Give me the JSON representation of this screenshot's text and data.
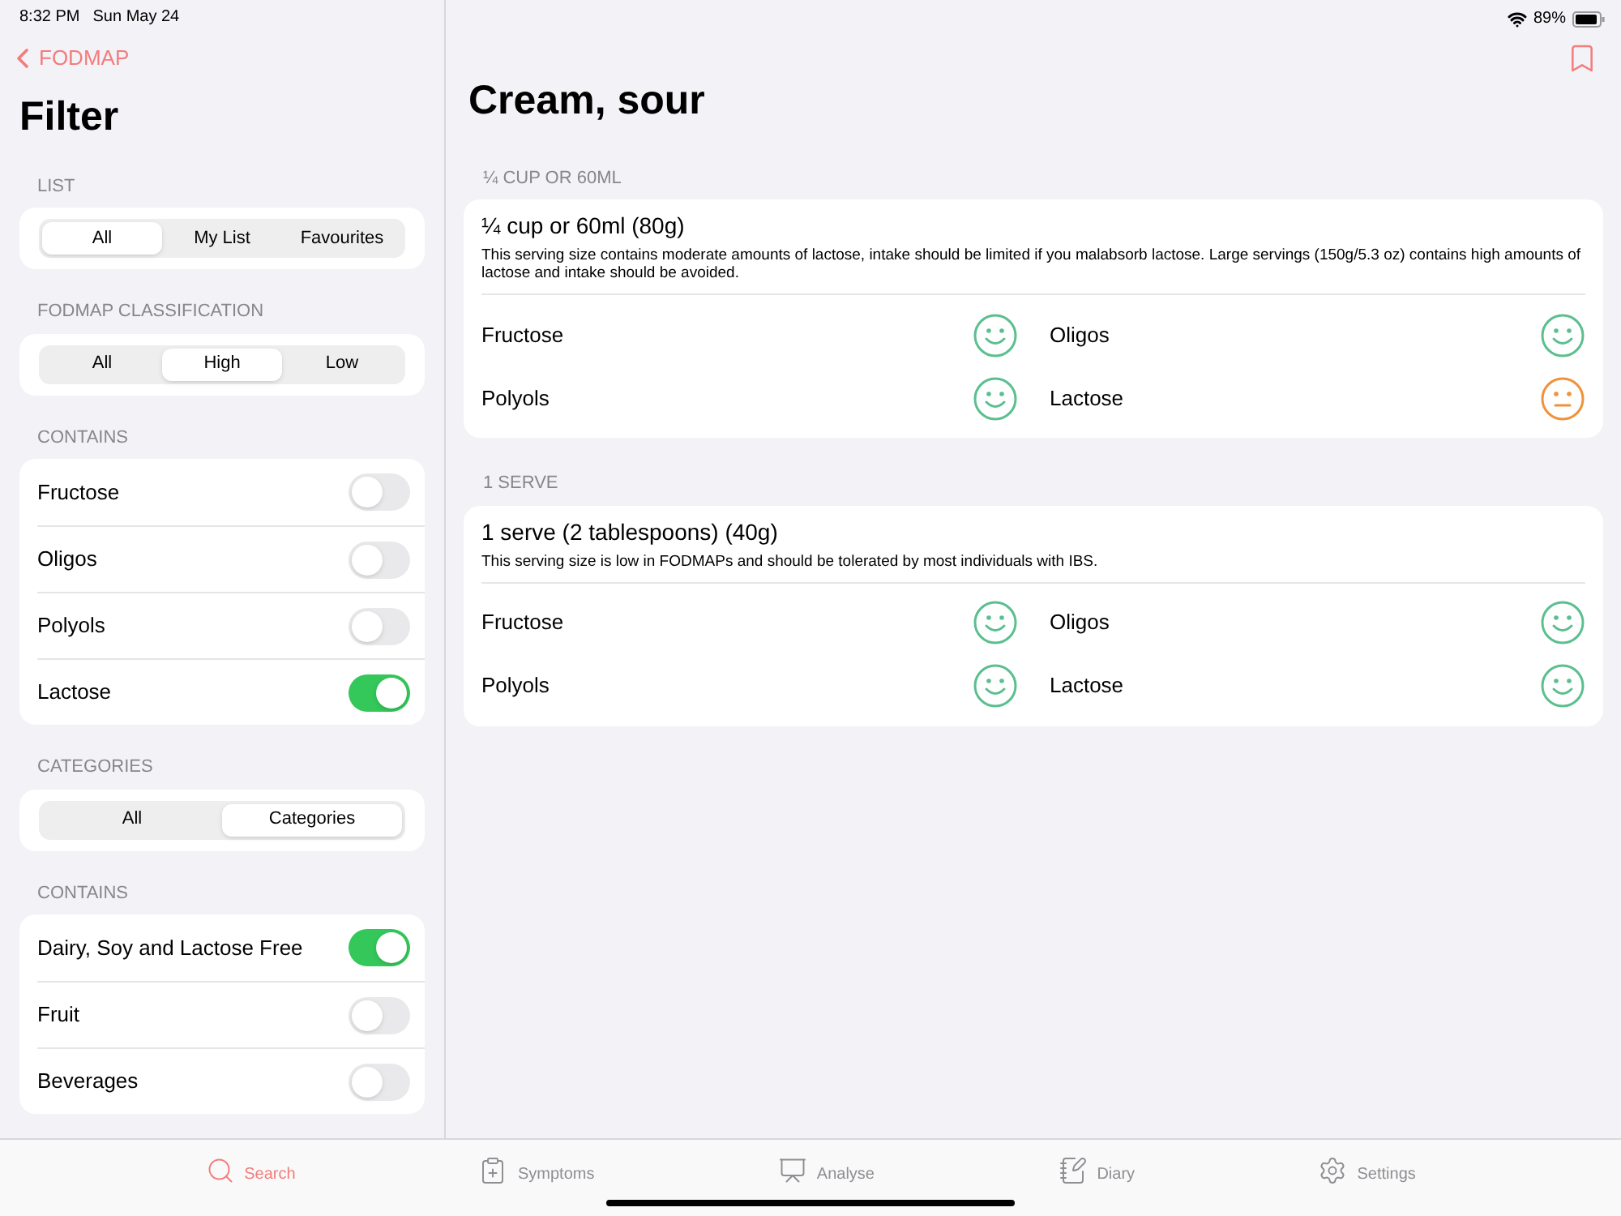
{
  "status_bar": {
    "time": "8:32 PM",
    "date": "Sun May 24",
    "battery": "89%"
  },
  "sidebar": {
    "back": "FODMAP",
    "title": "Filter",
    "sections": [
      {
        "kind": "segment",
        "header": "LIST",
        "options": [
          {
            "label": "All",
            "selected": true
          },
          {
            "label": "My List",
            "selected": false
          },
          {
            "label": "Favourites",
            "selected": false
          }
        ]
      },
      {
        "kind": "segment",
        "header": "FODMAP CLASSIFICATION",
        "options": [
          {
            "label": "All",
            "selected": false
          },
          {
            "label": "High",
            "selected": true
          },
          {
            "label": "Low",
            "selected": false
          }
        ]
      },
      {
        "kind": "toggles",
        "header": "CONTAINS",
        "items": [
          {
            "label": "Fructose",
            "on": false
          },
          {
            "label": "Oligos",
            "on": false
          },
          {
            "label": "Polyols",
            "on": false
          },
          {
            "label": "Lactose",
            "on": true
          }
        ]
      },
      {
        "kind": "segment",
        "header": "CATEGORIES",
        "options": [
          {
            "label": "All",
            "selected": false
          },
          {
            "label": "Categories",
            "selected": true
          }
        ]
      },
      {
        "kind": "toggles",
        "header": "CONTAINS",
        "items": [
          {
            "label": "Dairy, Soy and Lactose Free",
            "on": true
          },
          {
            "label": "Fruit",
            "on": false
          },
          {
            "label": "Beverages",
            "on": false
          }
        ]
      }
    ]
  },
  "detail": {
    "title": "Cream, sour",
    "servings": [
      {
        "header": "¼ CUP OR 60ML",
        "title": "¼ cup or 60ml (80g)",
        "description": "This serving size contains moderate amounts of lactose, intake should be limited if you malabsorb lactose. Large servings (150g/5.3 oz) contains high amounts of lactose and intake should be avoided.",
        "ratings": [
          {
            "label": "Fructose",
            "kind": "low"
          },
          {
            "label": "Oligos",
            "kind": "low"
          },
          {
            "label": "Polyols",
            "kind": "low"
          },
          {
            "label": "Lactose",
            "kind": "moderate"
          }
        ]
      },
      {
        "header": "1 SERVE",
        "title": "1 serve (2 tablespoons) (40g)",
        "description": "This serving size is low in FODMAPs and should be tolerated by most individuals with IBS.",
        "ratings": [
          {
            "label": "Fructose",
            "kind": "low"
          },
          {
            "label": "Oligos",
            "kind": "low"
          },
          {
            "label": "Polyols",
            "kind": "low"
          },
          {
            "label": "Lactose",
            "kind": "low"
          }
        ]
      }
    ]
  },
  "tab_bar": [
    {
      "label": "Search",
      "selected": true
    },
    {
      "label": "Symptoms",
      "selected": false
    },
    {
      "label": "Analyse",
      "selected": false
    },
    {
      "label": "Diary",
      "selected": false
    },
    {
      "label": "Settings",
      "selected": false
    }
  ]
}
